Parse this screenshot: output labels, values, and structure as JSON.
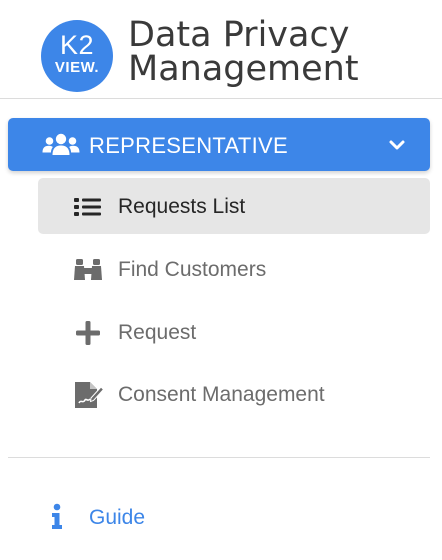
{
  "header": {
    "logo": {
      "line1": "K2",
      "line2": "VIEW."
    },
    "title_line1": "Data Privacy",
    "title_line2": "Management"
  },
  "colors": {
    "accent": "#3d86e8",
    "active_bg": "#e6e6e6",
    "muted_text": "#6c6c6c",
    "dark_text": "#262626",
    "divider": "#dcdcdc"
  },
  "nav": {
    "section": {
      "label": "REPRESENTATIVE",
      "icon": "users-icon",
      "expanded": true,
      "toggle_icon": "chevron-down-icon"
    },
    "items": [
      {
        "label": "Requests List",
        "icon": "list-icon",
        "active": true
      },
      {
        "label": "Find Customers",
        "icon": "binoculars-icon",
        "active": false
      },
      {
        "label": "Request",
        "icon": "plus-icon",
        "active": false
      },
      {
        "label": "Consent Management",
        "icon": "signature-icon",
        "active": false
      }
    ],
    "guide": {
      "label": "Guide",
      "icon": "info-icon"
    }
  }
}
